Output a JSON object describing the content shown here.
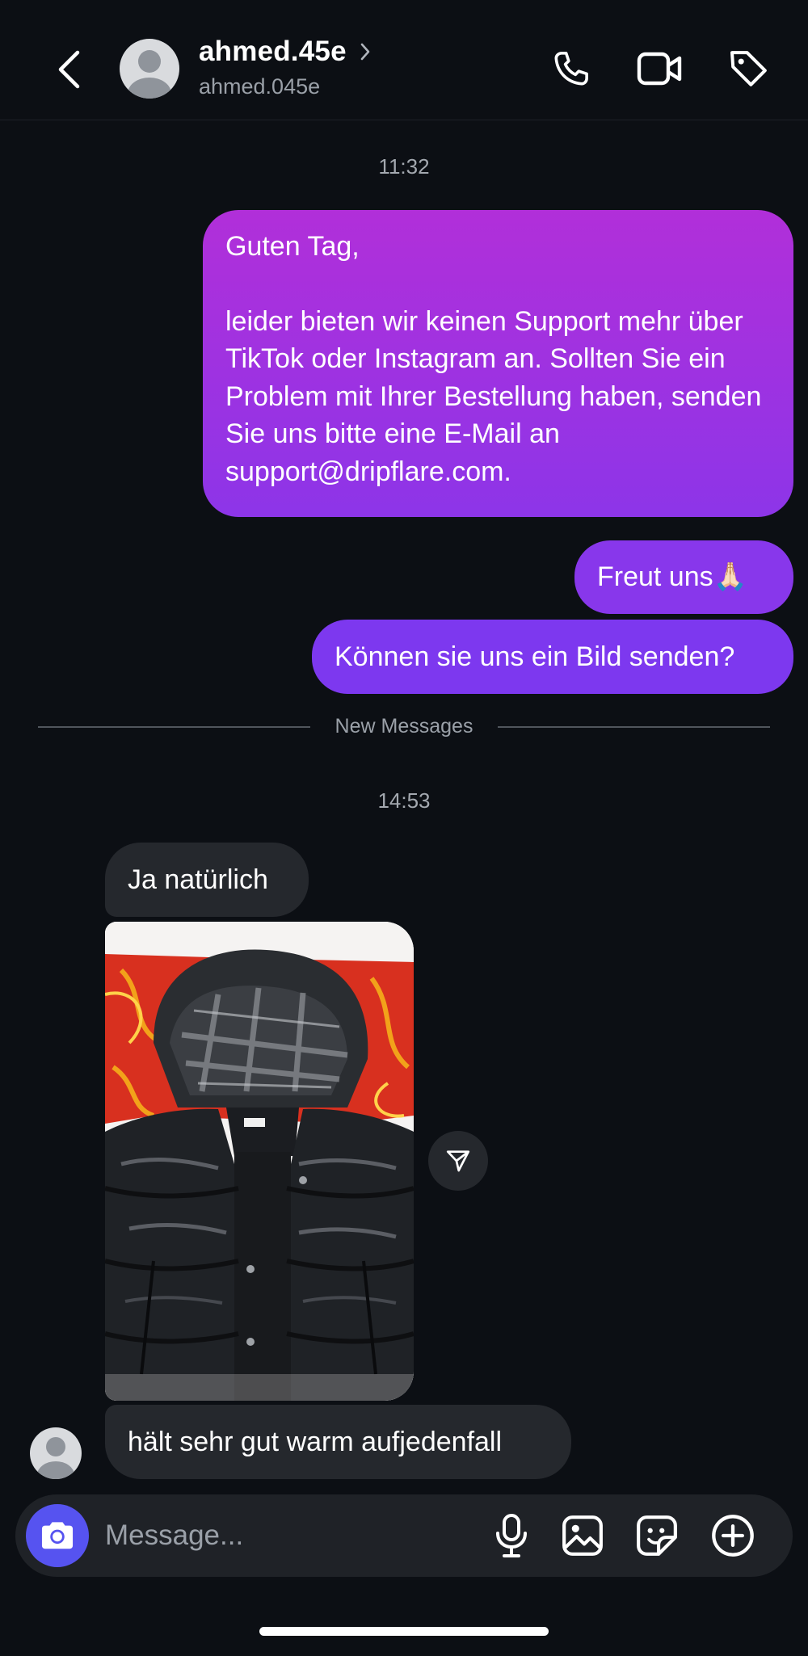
{
  "header": {
    "display_name": "ahmed.45e",
    "username": "ahmed.045e",
    "icons": [
      "back-chevron-icon",
      "avatar",
      "chevron-right-icon",
      "phone-icon",
      "video-camera-icon",
      "tag-icon"
    ]
  },
  "messages": {
    "timestamp_1": "11:32",
    "out_1_greeting": "Guten Tag,",
    "out_1_body": "leider bieten wir keinen Support mehr über TikTok oder Instagram an. Sollten Sie ein Problem mit Ihrer Bestellung haben, senden Sie uns bitte eine E-Mail an support@dripflare.com.",
    "out_2": "Freut uns🙏🏻",
    "out_3": "Können sie uns ein Bild senden?",
    "new_messages_label": "New Messages",
    "timestamp_2": "14:53",
    "in_1": "Ja natürlich",
    "in_2": "hält sehr gut warm aufjedenfall"
  },
  "composer": {
    "placeholder": "Message...",
    "icons": [
      "camera-icon",
      "microphone-icon",
      "gallery-icon",
      "sticker-icon",
      "plus-circle-icon"
    ]
  },
  "colors": {
    "background": "#0c0f14",
    "outgoing_gradient_top": "#b12fd9",
    "outgoing_gradient_bottom": "#7b37ef",
    "incoming_bubble": "#25282d",
    "camera_button": "#5653f0"
  }
}
